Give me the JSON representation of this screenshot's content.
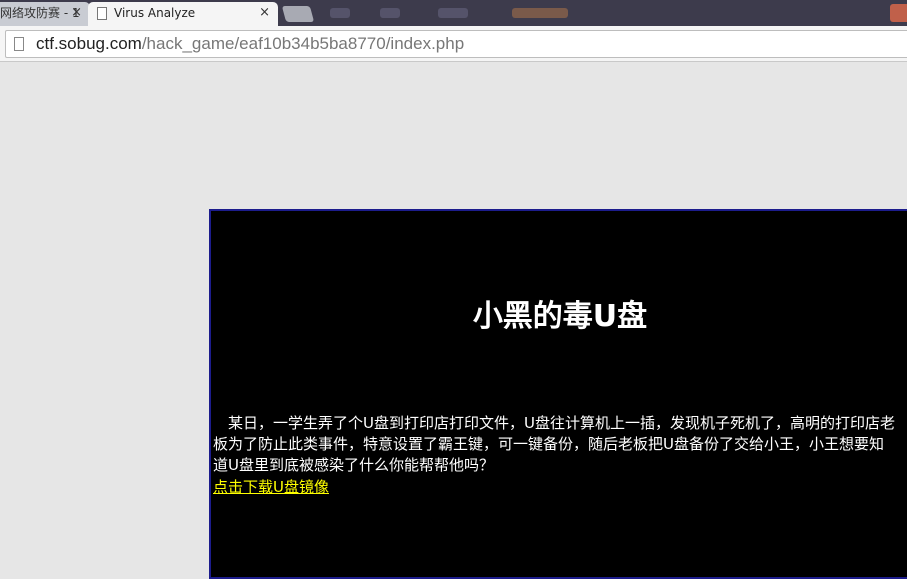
{
  "browser": {
    "tabs": [
      {
        "label": "网络攻防赛 - 1",
        "close": "×"
      },
      {
        "label": "Virus Analyze",
        "close": "×"
      }
    ],
    "url_host": "ctf.sobug.com",
    "url_path": "/hack_game/eaf10b34b5ba8770/index.php"
  },
  "page": {
    "title": "小黑的毒U盘",
    "description": "某日，一学生弄了个U盘到打印店打印文件，U盘往计算机上一插，发现机子死机了，高明的打印店老板为了防止此类事件，特意设置了霸王键，可一键备份，随后老板把U盘备份了交给小王，小王想要知道U盘里到底被感染了什么你能帮帮他吗？",
    "download_link": "点击下载U盘镜像"
  }
}
